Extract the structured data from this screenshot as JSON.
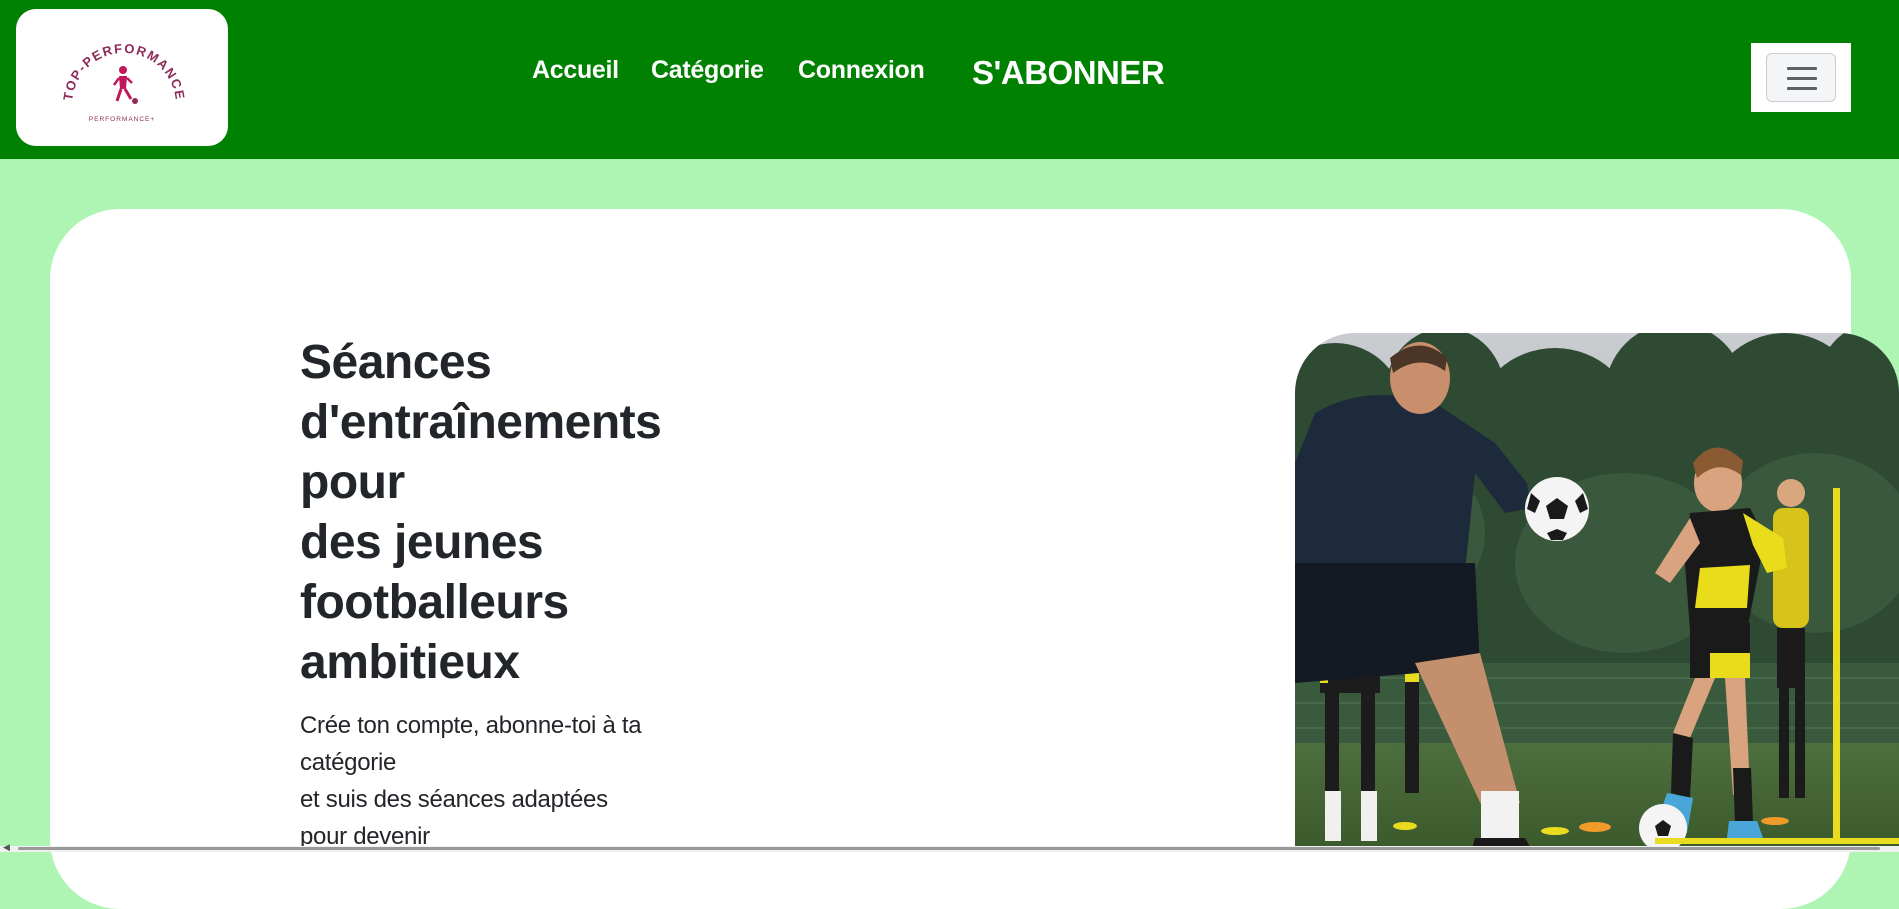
{
  "logo": {
    "arc_text": "TOP-PERFORMANCE",
    "sub_text": "PERFORMANCE+",
    "colors": {
      "text": "#8e2a59",
      "figure": "#c2185b"
    }
  },
  "nav": {
    "links": [
      "Accueil",
      "Catégorie",
      "Connexion"
    ],
    "cta": "S'ABONNER",
    "menu_icon": "hamburger-icon"
  },
  "hero": {
    "title_lines": [
      "Séances",
      "d'entraînements",
      "pour",
      "des jeunes",
      "footballeurs",
      "ambitieux"
    ],
    "text_lines": [
      "Crée ton compte, abonne-toi à ta",
      "catégorie",
      "et suis des séances adaptées",
      "pour devenir"
    ]
  },
  "colors": {
    "navbar": "#018101",
    "page_background": "#aef5b3",
    "card": "#ffffff",
    "text": "#222529"
  }
}
